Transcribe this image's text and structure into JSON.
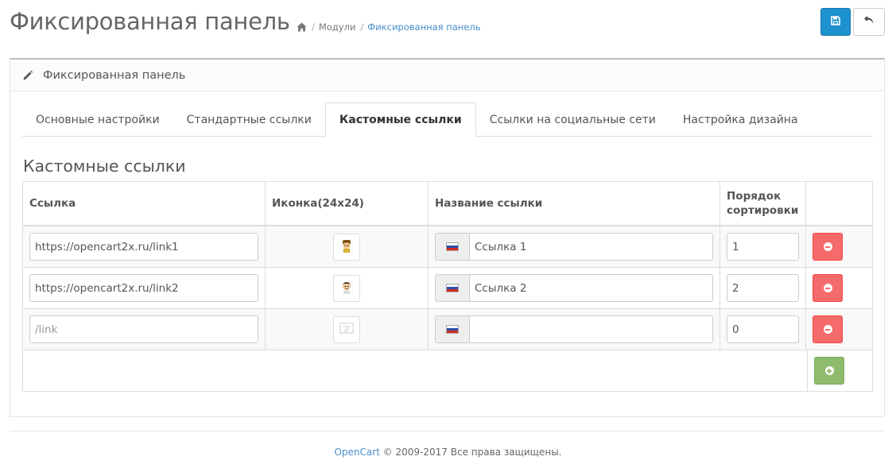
{
  "header": {
    "title": "Фиксированная панель",
    "breadcrumb": {
      "home_icon": "home-icon",
      "items": [
        "Модули",
        "Фиксированная панель"
      ]
    },
    "save_icon": "save-icon",
    "back_icon": "reply-icon"
  },
  "panel": {
    "heading": "Фиксированная панель",
    "heading_icon": "pencil-icon",
    "tabs": [
      {
        "label": "Основные настройки",
        "active": false
      },
      {
        "label": "Стандартные ссылки",
        "active": false
      },
      {
        "label": "Кастомные ссылки",
        "active": true
      },
      {
        "label": "Ссылки на социальные сети",
        "active": false
      },
      {
        "label": "Настройка дизайна",
        "active": false
      }
    ],
    "section_title": "Кастомные ссылки",
    "table": {
      "columns": [
        "Ссылка",
        "Иконка(24x24)",
        "Название ссылки",
        "Порядок сортировки"
      ],
      "rows": [
        {
          "link": "https://opencart2x.ru/link1",
          "icon": "character-icon-1",
          "name": "Ссылка 1",
          "order": "1"
        },
        {
          "link": "https://opencart2x.ru/link2",
          "icon": "character-icon-2",
          "name": "Ссылка 2",
          "order": "2"
        },
        {
          "link": "",
          "link_placeholder": "/link",
          "icon": "no-image-icon",
          "name": "",
          "order": "0"
        }
      ],
      "delete_icon": "minus-circle-icon",
      "add_icon": "plus-circle-icon"
    }
  },
  "footer": {
    "brand": "OpenCart",
    "text": " © 2009-2017 Все права защищены."
  },
  "colors": {
    "primary": "#1e91cf",
    "danger": "#f56b6b",
    "success": "#8fbb6c",
    "link": "#4a8dc9"
  }
}
